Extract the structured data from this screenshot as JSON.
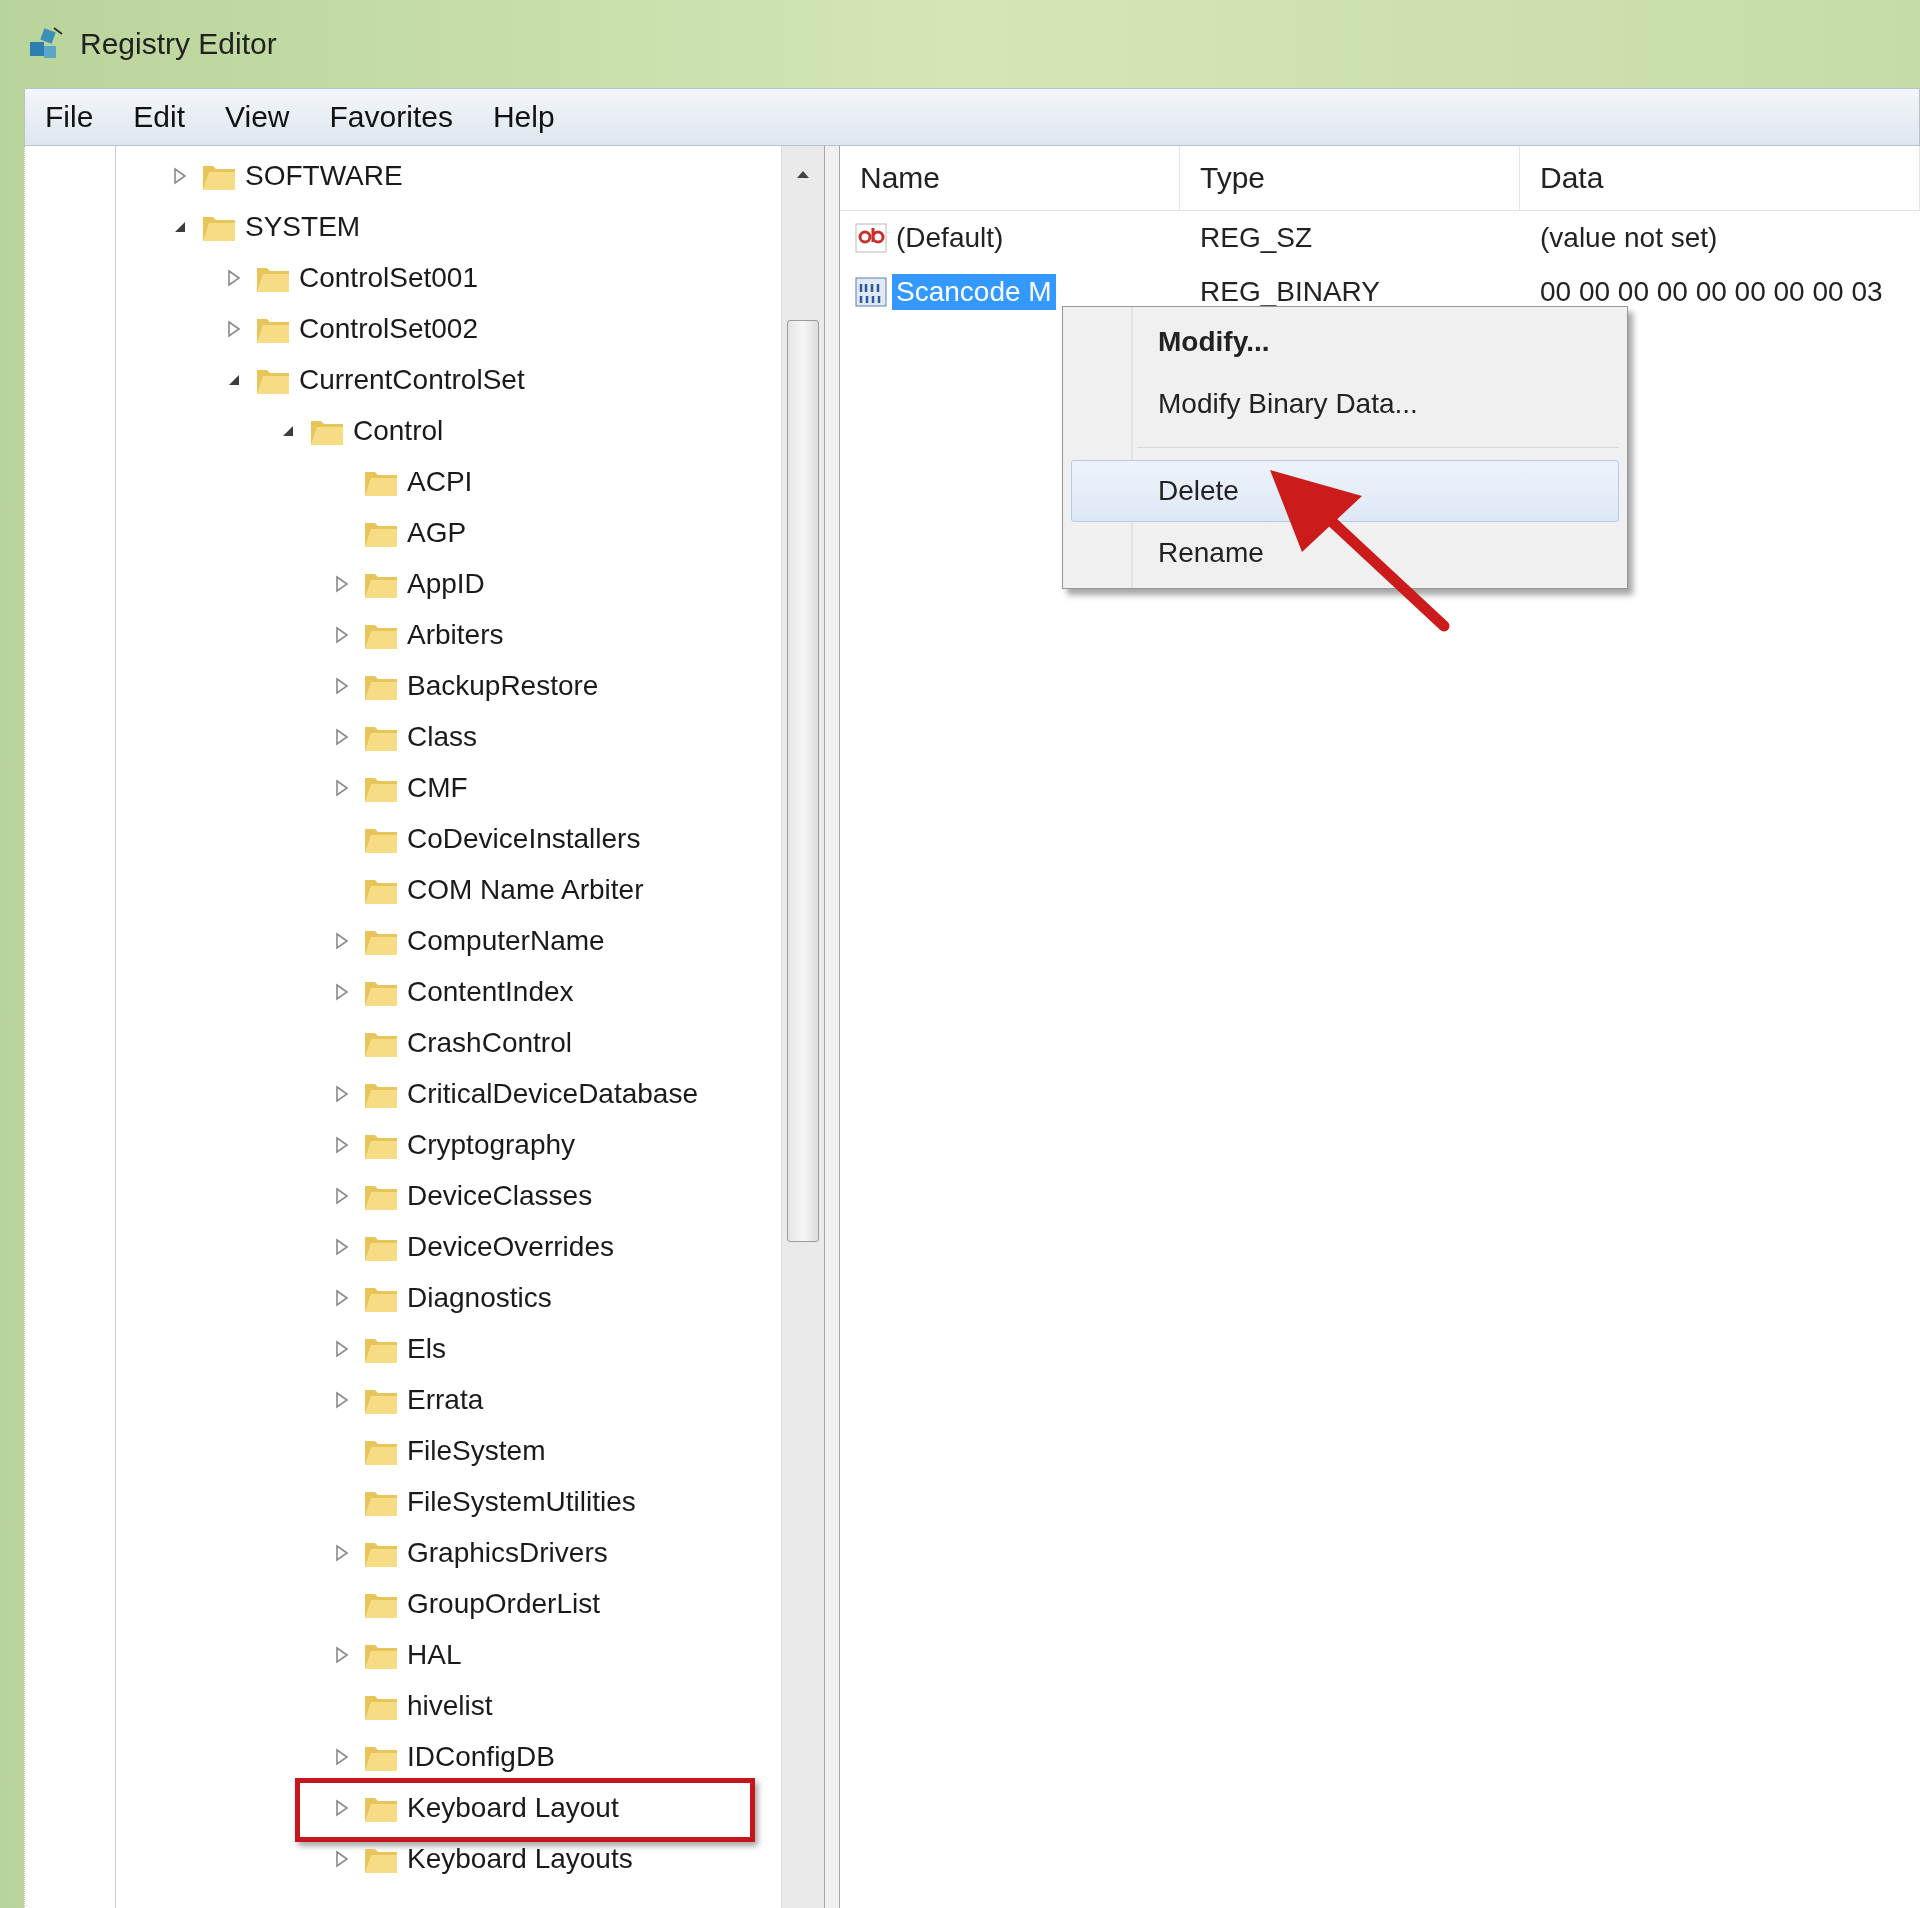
{
  "window": {
    "title": "Registry Editor"
  },
  "menu_bar": [
    {
      "label": "File"
    },
    {
      "label": "Edit"
    },
    {
      "label": "View"
    },
    {
      "label": "Favorites"
    },
    {
      "label": "Help"
    }
  ],
  "tree": [
    {
      "label": "SOFTWARE",
      "expanded": false
    },
    {
      "label": "SYSTEM",
      "expanded": true,
      "children": [
        {
          "label": "ControlSet001",
          "expanded": false
        },
        {
          "label": "ControlSet002",
          "expanded": false
        },
        {
          "label": "CurrentControlSet",
          "expanded": true,
          "children": [
            {
              "label": "Control",
              "expanded": true,
              "children": [
                {
                  "label": "ACPI"
                },
                {
                  "label": "AGP"
                },
                {
                  "label": "AppID",
                  "expanded": false
                },
                {
                  "label": "Arbiters",
                  "expanded": false
                },
                {
                  "label": "BackupRestore",
                  "expanded": false
                },
                {
                  "label": "Class",
                  "expanded": false
                },
                {
                  "label": "CMF",
                  "expanded": false
                },
                {
                  "label": "CoDeviceInstallers"
                },
                {
                  "label": "COM Name Arbiter"
                },
                {
                  "label": "ComputerName",
                  "expanded": false
                },
                {
                  "label": "ContentIndex",
                  "expanded": false
                },
                {
                  "label": "CrashControl"
                },
                {
                  "label": "CriticalDeviceDatabase",
                  "expanded": false
                },
                {
                  "label": "Cryptography",
                  "expanded": false
                },
                {
                  "label": "DeviceClasses",
                  "expanded": false
                },
                {
                  "label": "DeviceOverrides",
                  "expanded": false
                },
                {
                  "label": "Diagnostics",
                  "expanded": false
                },
                {
                  "label": "Els",
                  "expanded": false
                },
                {
                  "label": "Errata",
                  "expanded": false
                },
                {
                  "label": "FileSystem"
                },
                {
                  "label": "FileSystemUtilities"
                },
                {
                  "label": "GraphicsDrivers",
                  "expanded": false
                },
                {
                  "label": "GroupOrderList"
                },
                {
                  "label": "HAL",
                  "expanded": false
                },
                {
                  "label": "hivelist"
                },
                {
                  "label": "IDConfigDB",
                  "expanded": false
                },
                {
                  "label": "Keyboard Layout",
                  "expanded": false,
                  "highlighted": true
                },
                {
                  "label": "Keyboard Layouts",
                  "expanded": false
                }
              ]
            }
          ]
        }
      ]
    }
  ],
  "values": {
    "columns": [
      "Name",
      "Type",
      "Data"
    ],
    "rows": [
      {
        "kind": "string",
        "name": "(Default)",
        "type": "REG_SZ",
        "data": "(value not set)",
        "selected": false
      },
      {
        "kind": "binary",
        "name": "Scancode M",
        "type": "REG_BINARY",
        "data": "00 00 00 00 00 00 00 00 03",
        "selected": true
      }
    ]
  },
  "context_menu": [
    {
      "kind": "item",
      "label": "Modify...",
      "default": true,
      "selected": false
    },
    {
      "kind": "item",
      "label": "Modify Binary Data...",
      "default": false,
      "selected": false
    },
    {
      "kind": "separator"
    },
    {
      "kind": "item",
      "label": "Delete",
      "default": false,
      "selected": true
    },
    {
      "kind": "item",
      "label": "Rename",
      "default": false,
      "selected": false
    }
  ]
}
